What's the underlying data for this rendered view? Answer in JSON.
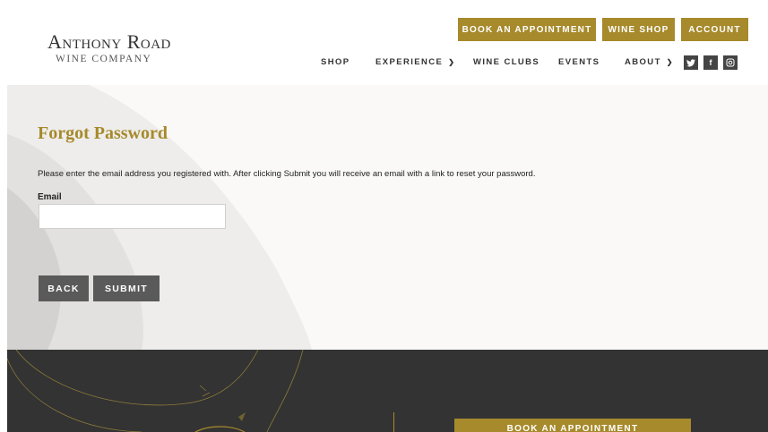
{
  "brand": {
    "name_line1": "Anthony Road",
    "name_line2": "WINE COMPANY",
    "accent_color": "#a68a2b"
  },
  "top_buttons": {
    "book": "BOOK AN APPOINTMENT",
    "wine_shop": "WINE SHOP",
    "account": "ACCOUNT"
  },
  "nav": {
    "shop": "SHOP",
    "experience": "EXPERIENCE",
    "wine_clubs": "WINE CLUBS",
    "events": "EVENTS",
    "about": "ABOUT"
  },
  "social": {
    "twitter": "twitter-icon",
    "facebook": "facebook-icon",
    "instagram": "instagram-icon"
  },
  "form": {
    "title": "Forgot Password",
    "description": "Please enter the email address you registered with. After clicking Submit you will receive an email with a link to reset your password.",
    "email_label": "Email",
    "email_value": "",
    "back_label": "BACK",
    "submit_label": "SUBMIT"
  },
  "footer": {
    "book_label": "BOOK AN APPOINTMENT",
    "background_color": "#333333"
  }
}
